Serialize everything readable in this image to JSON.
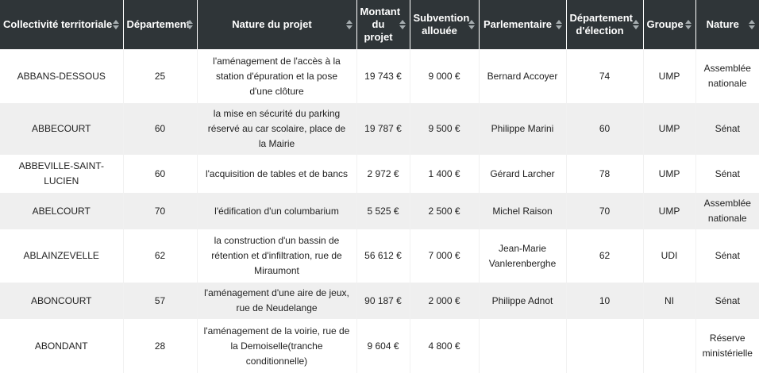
{
  "table": {
    "columns": [
      {
        "label": "Collectivité territoriale"
      },
      {
        "label": "Département"
      },
      {
        "label": "Nature du projet"
      },
      {
        "label": "Montant du projet"
      },
      {
        "label": "Subvention allouée"
      },
      {
        "label": "Parlementaire"
      },
      {
        "label": "Département d'élection"
      },
      {
        "label": "Groupe"
      },
      {
        "label": "Nature"
      }
    ],
    "rows": [
      [
        "ABBANS-DESSOUS",
        "25",
        "l'aménagement de l'accès à la station d'épuration et la pose d'une clôture",
        "19 743 €",
        "9 000 €",
        "Bernard Accoyer",
        "74",
        "UMP",
        "Assemblée nationale"
      ],
      [
        "ABBECOURT",
        "60",
        "la mise en sécurité du parking réservé au car scolaire, place de la Mairie",
        "19 787 €",
        "9 500 €",
        "Philippe Marini",
        "60",
        "UMP",
        "Sénat"
      ],
      [
        "ABBEVILLE-SAINT-LUCIEN",
        "60",
        "l'acquisition de tables et de bancs",
        "2 972 €",
        "1 400 €",
        "Gérard Larcher",
        "78",
        "UMP",
        "Sénat"
      ],
      [
        "ABELCOURT",
        "70",
        "l'édification d'un columbarium",
        "5 525 €",
        "2 500 €",
        "Michel Raison",
        "70",
        "UMP",
        "Assemblée nationale"
      ],
      [
        "ABLAINZEVELLE",
        "62",
        "la construction d'un bassin de rétention et d'infiltration, rue de Miraumont",
        "56 612 €",
        "7 000 €",
        "Jean-Marie Vanlerenberghe",
        "62",
        "UDI",
        "Sénat"
      ],
      [
        "ABONCOURT",
        "57",
        "l'aménagement d'une aire de jeux, rue de Neudelange",
        "90 187 €",
        "2 000 €",
        "Philippe Adnot",
        "10",
        "NI",
        "Sénat"
      ],
      [
        "ABONDANT",
        "28",
        "l'aménagement de la voirie, rue de la Demoiselle(tranche conditionnelle)",
        "9 604 €",
        "4 800 €",
        "",
        "",
        "",
        "Réserve ministérielle"
      ]
    ]
  }
}
